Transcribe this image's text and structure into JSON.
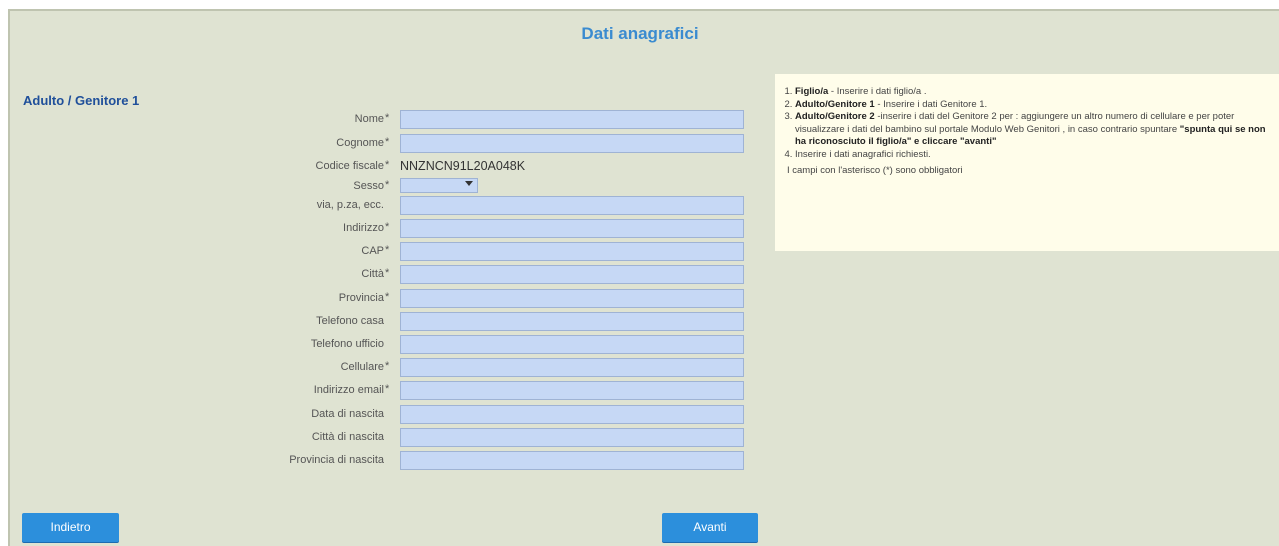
{
  "title": "Dati anagrafici",
  "section_title": "Adulto / Genitore 1",
  "fields": [
    {
      "label": "Nome",
      "required": "*",
      "value": ""
    },
    {
      "label": "Cognome",
      "required": "*",
      "value": ""
    },
    {
      "label": "Codice fiscale",
      "required": "*",
      "value": "NNZNCN91L20A048K"
    },
    {
      "label": "Sesso",
      "required": "*",
      "value": ""
    },
    {
      "label": "via, p.za, ecc.",
      "required": "",
      "value": ""
    },
    {
      "label": "Indirizzo",
      "required": "*",
      "value": ""
    },
    {
      "label": "CAP",
      "required": "*",
      "value": ""
    },
    {
      "label": "Città",
      "required": "*",
      "value": ""
    },
    {
      "label": "Provincia",
      "required": "*",
      "value": ""
    },
    {
      "label": "Telefono casa",
      "required": "",
      "value": ""
    },
    {
      "label": "Telefono ufficio",
      "required": "",
      "value": ""
    },
    {
      "label": "Cellulare",
      "required": "*",
      "value": ""
    },
    {
      "label": "Indirizzo email",
      "required": "*",
      "value": ""
    },
    {
      "label": "Data di nascita",
      "required": "",
      "value": ""
    },
    {
      "label": "Città di nascita",
      "required": "",
      "value": ""
    },
    {
      "label": "Provincia di nascita",
      "required": "",
      "value": ""
    }
  ],
  "info": {
    "i1_bold": "Figlio/a",
    "i1_text": "- Inserire i dati figlio/a .",
    "i2_bold": "Adulto/Genitore 1",
    "i2_text": "- Inserire i dati Genitore 1.",
    "i3_bold": "Adulto/Genitore 2",
    "i3_text": " -inserire i dati del Genitore 2 per : aggiungere un altro numero di cellulare e per poter visualizzare i dati del bambino sul portale Modulo Web Genitori , in caso contrario spuntare ",
    "i3_bold2": "\"spunta qui se non ha riconosciuto il figlio/a\" e cliccare \"avanti\"",
    "i4_text": "Inserire i dati anagrafici richiesti.",
    "note": "I campi con l'asterisco (*) sono obbligatori"
  },
  "buttons": {
    "back": "Indietro",
    "next": "Avanti"
  }
}
